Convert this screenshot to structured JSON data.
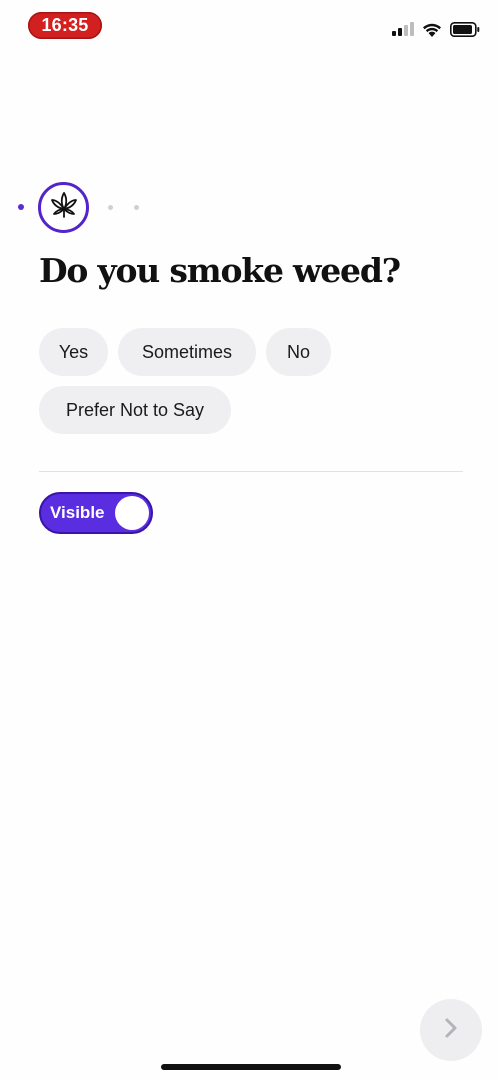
{
  "status_bar": {
    "time": "16:35",
    "icons": [
      "cellular-signal-icon",
      "wifi-icon",
      "battery-icon"
    ]
  },
  "progress": {
    "current_step_icon": "cannabis-leaf-icon",
    "accent_color": "#5224c9"
  },
  "question": {
    "title": "Do you smoke weed?"
  },
  "options": [
    "Yes",
    "Sometimes",
    "No",
    "Prefer Not to Say"
  ],
  "visibility_toggle": {
    "label": "Visible",
    "on": true,
    "color": "#5a2ee0"
  },
  "next_button": {
    "icon": "chevron-right-icon",
    "enabled": false
  }
}
